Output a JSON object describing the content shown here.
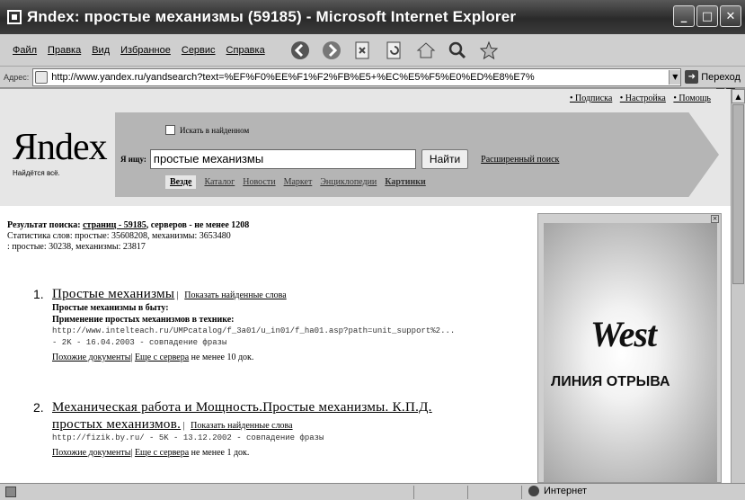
{
  "window": {
    "title": "Яndex: простые механизмы (59185) - Microsoft Internet Explorer"
  },
  "menu": [
    "Файл",
    "Правка",
    "Вид",
    "Избранное",
    "Сервис",
    "Справка"
  ],
  "address": {
    "label": "Адрес:",
    "url": "http://www.yandex.ru/yandsearch?text=%EF%F0%EE%F1%F2%FB%E5+%EC%E5%F5%E0%ED%E8%E7%",
    "go_label": "Переход"
  },
  "header": {
    "top_links": [
      "• Подписка",
      "• Настройка",
      "• Помощь"
    ],
    "logo": "Яndex",
    "tagline": "Найдётся всё.",
    "checkbox_label": "Искать в найденном",
    "search_label": "Я ищу:",
    "query": "простые механизмы",
    "find_label": "Найти",
    "advanced_link": "Расширенный поиск",
    "tabs": [
      "Везде",
      "Каталог",
      "Новости",
      "Маркет",
      "Энциклопедии",
      "Картинки"
    ]
  },
  "stats": {
    "line1_prefix": "Результат поиска:",
    "pages_link": "страниц - 59185",
    "line1_suffix": ", серверов - не менее 1208",
    "line2": "Статистика слов: простые: 35608208, механизмы: 3653480",
    "line3": ": простые: 30238, механизмы: 23817"
  },
  "results": [
    {
      "num": "1.",
      "title": "Простые механизмы",
      "show_words": "Показать найденные слова",
      "snippet1": "Простые механизмы в быту:",
      "snippet2": "Применение простых механизмов в технике:",
      "url_line": "http://www.intelteach.ru/UMPcatalog/f_3a01/u_in01/f_ha01.asp?path=unit_support%2...",
      "meta": "- 2K - 16.04.2003 - совпадение фразы",
      "similar": "Похожие документы",
      "more": "Еще с сервера",
      "more_suffix": "не менее 10 док."
    },
    {
      "num": "2.",
      "title": "Механическая работа и Мощность.Простые механизмы. К.П.Д.",
      "title2": "простых механизмов.",
      "show_words": "Показать найденные слова",
      "url_line": "http://fizik.by.ru/ - 5K - 13.12.2002 - совпадение фразы",
      "similar": "Похожие документы",
      "more": "Еще с сервера",
      "more_suffix": "не менее 1 док."
    }
  ],
  "ad": {
    "brand": "West",
    "slogan": "ЛИНИЯ ОТРЫВА",
    "close": "×"
  },
  "status": {
    "zone": "Интернет"
  }
}
